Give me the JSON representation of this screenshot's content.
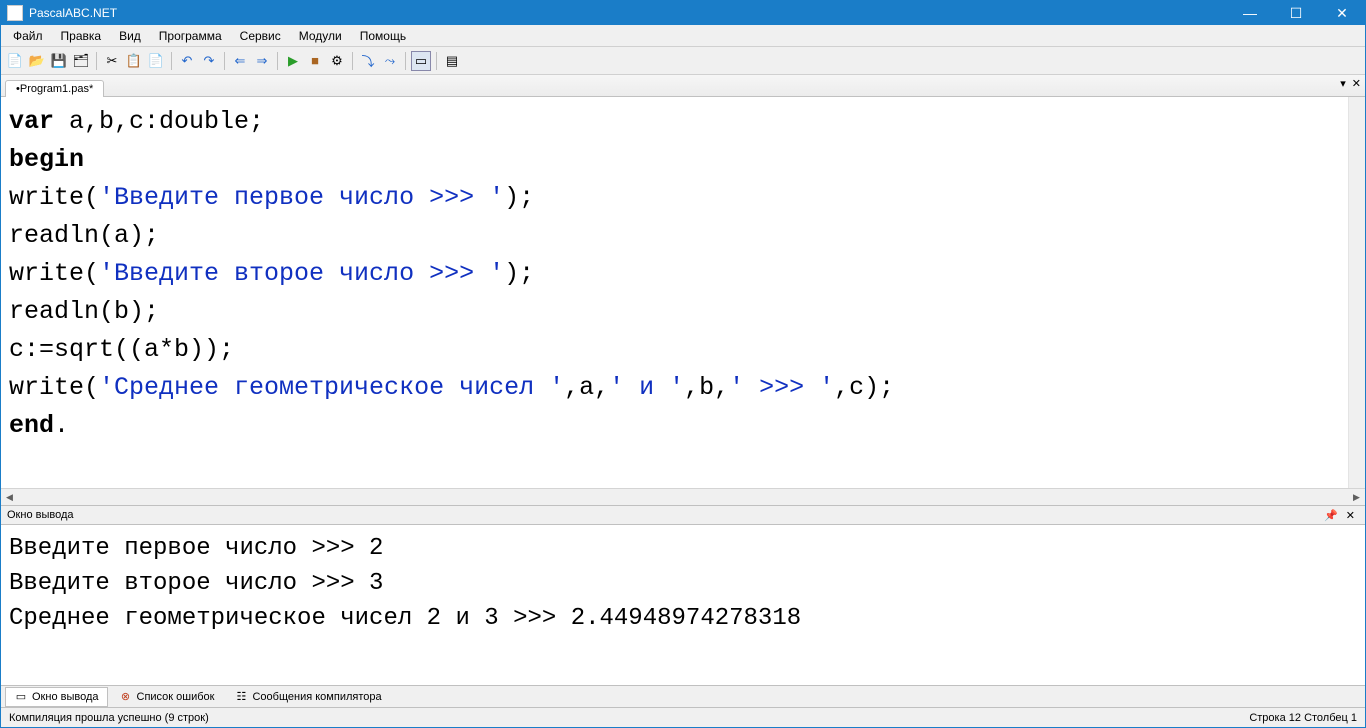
{
  "title": "PascalABC.NET",
  "menu": [
    "Файл",
    "Правка",
    "Вид",
    "Программа",
    "Сервис",
    "Модули",
    "Помощь"
  ],
  "tab": "•Program1.pas*",
  "code": {
    "l1a": "var",
    "l1b": " a,b,c:double;",
    "l2": "begin",
    "l3a": "write(",
    "l3b": "'Введите первое число >>> '",
    "l3c": ");",
    "l4": "readln(a);",
    "l5a": "write(",
    "l5b": "'Введите второе число >>> '",
    "l5c": ");",
    "l6": "readln(b);",
    "l7": "c:=sqrt((a*b));",
    "l8a": "write(",
    "l8b": "'Среднее геометрическое чисел '",
    "l8c": ",a,",
    "l8d": "' и '",
    "l8e": ",b,",
    "l8f": "' >>> '",
    "l8g": ",c);",
    "l9a": "end",
    "l9b": "."
  },
  "output_panel_title": "Окно вывода",
  "output_lines": {
    "o1": "Введите первое число >>> 2",
    "o2": "Введите второе число >>> 3",
    "o3": "Среднее геометрическое чисел 2 и 3 >>> 2.44948974278318"
  },
  "bottom_tabs": {
    "t1": "Окно вывода",
    "t2": "Список ошибок",
    "t3": "Сообщения компилятора"
  },
  "status_left": "Компиляция прошла успешно (9 строк)",
  "status_right": "Строка  12  Столбец  1",
  "win_btns": {
    "min": "—",
    "max": "☐",
    "close": "✕"
  },
  "tab_ctrl": {
    "dd": "▾",
    "x": "✕"
  },
  "pin": "📌"
}
